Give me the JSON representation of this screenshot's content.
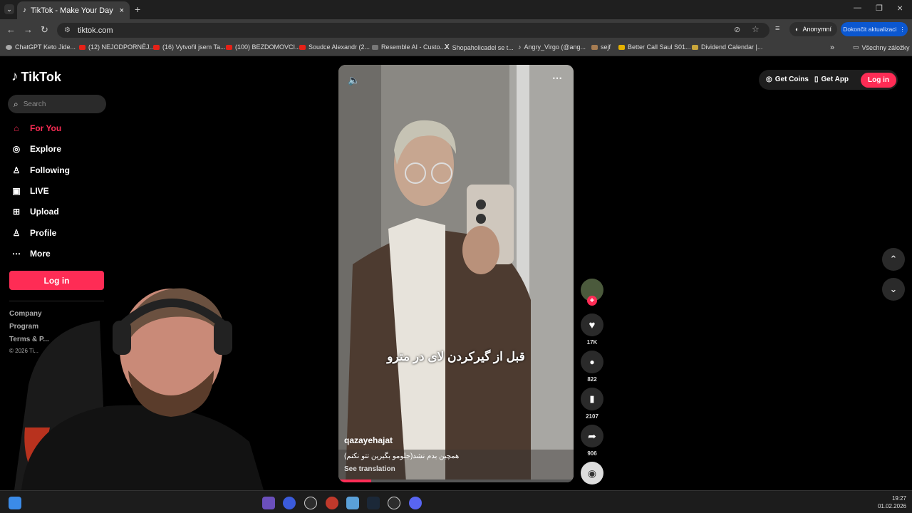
{
  "browser": {
    "tab_title": "TikTok - Make Your Day",
    "url": "tiktok.com",
    "profile": "Anonymní",
    "update_button": "Dokončit aktualizaci",
    "bookmarks": [
      "ChatGPT",
      "Keto Jide...",
      "(12) NEJODPORNĚJ...",
      "(16) Vytvořil jsem Ta...",
      "(100) BEZDOMOVCI...",
      "Soudce Alexandr (2...",
      "Resemble AI - Custo...",
      "Shopaholicadel se t...",
      "Angry_Virgo (@ang...",
      "sejf",
      "Better Call Saul S01...",
      "Dividend Calendar |..."
    ],
    "all_bookmarks": "Všechny záložky"
  },
  "sidebar": {
    "logo": "TikTok",
    "search_placeholder": "Search",
    "nav": [
      "For You",
      "Explore",
      "Following",
      "LIVE",
      "Upload",
      "Profile",
      "More"
    ],
    "login": "Log in",
    "footer": [
      "Company",
      "Program",
      "Terms & P...",
      "© 2026 Ti..."
    ]
  },
  "video": {
    "caption_overlay": "قبل از گیرکردن لای در مترو",
    "author": "qazayehajat",
    "description": "(جلومو بگیرین تتو نکنم)همچین بدم نشد",
    "see_translation": "See translation"
  },
  "actions": {
    "likes": "17K",
    "comments": "822",
    "saves": "2107",
    "shares": "906"
  },
  "header": {
    "get_coins": "Get Coins",
    "get_app": "Get App",
    "login": "Log in"
  },
  "taskbar": {
    "time": "19:27",
    "date": "01.02.2026"
  },
  "colors": {
    "brand": "#fe2c55",
    "chrome_bg": "#3c3c3c",
    "update_blue": "#0b57d0"
  }
}
